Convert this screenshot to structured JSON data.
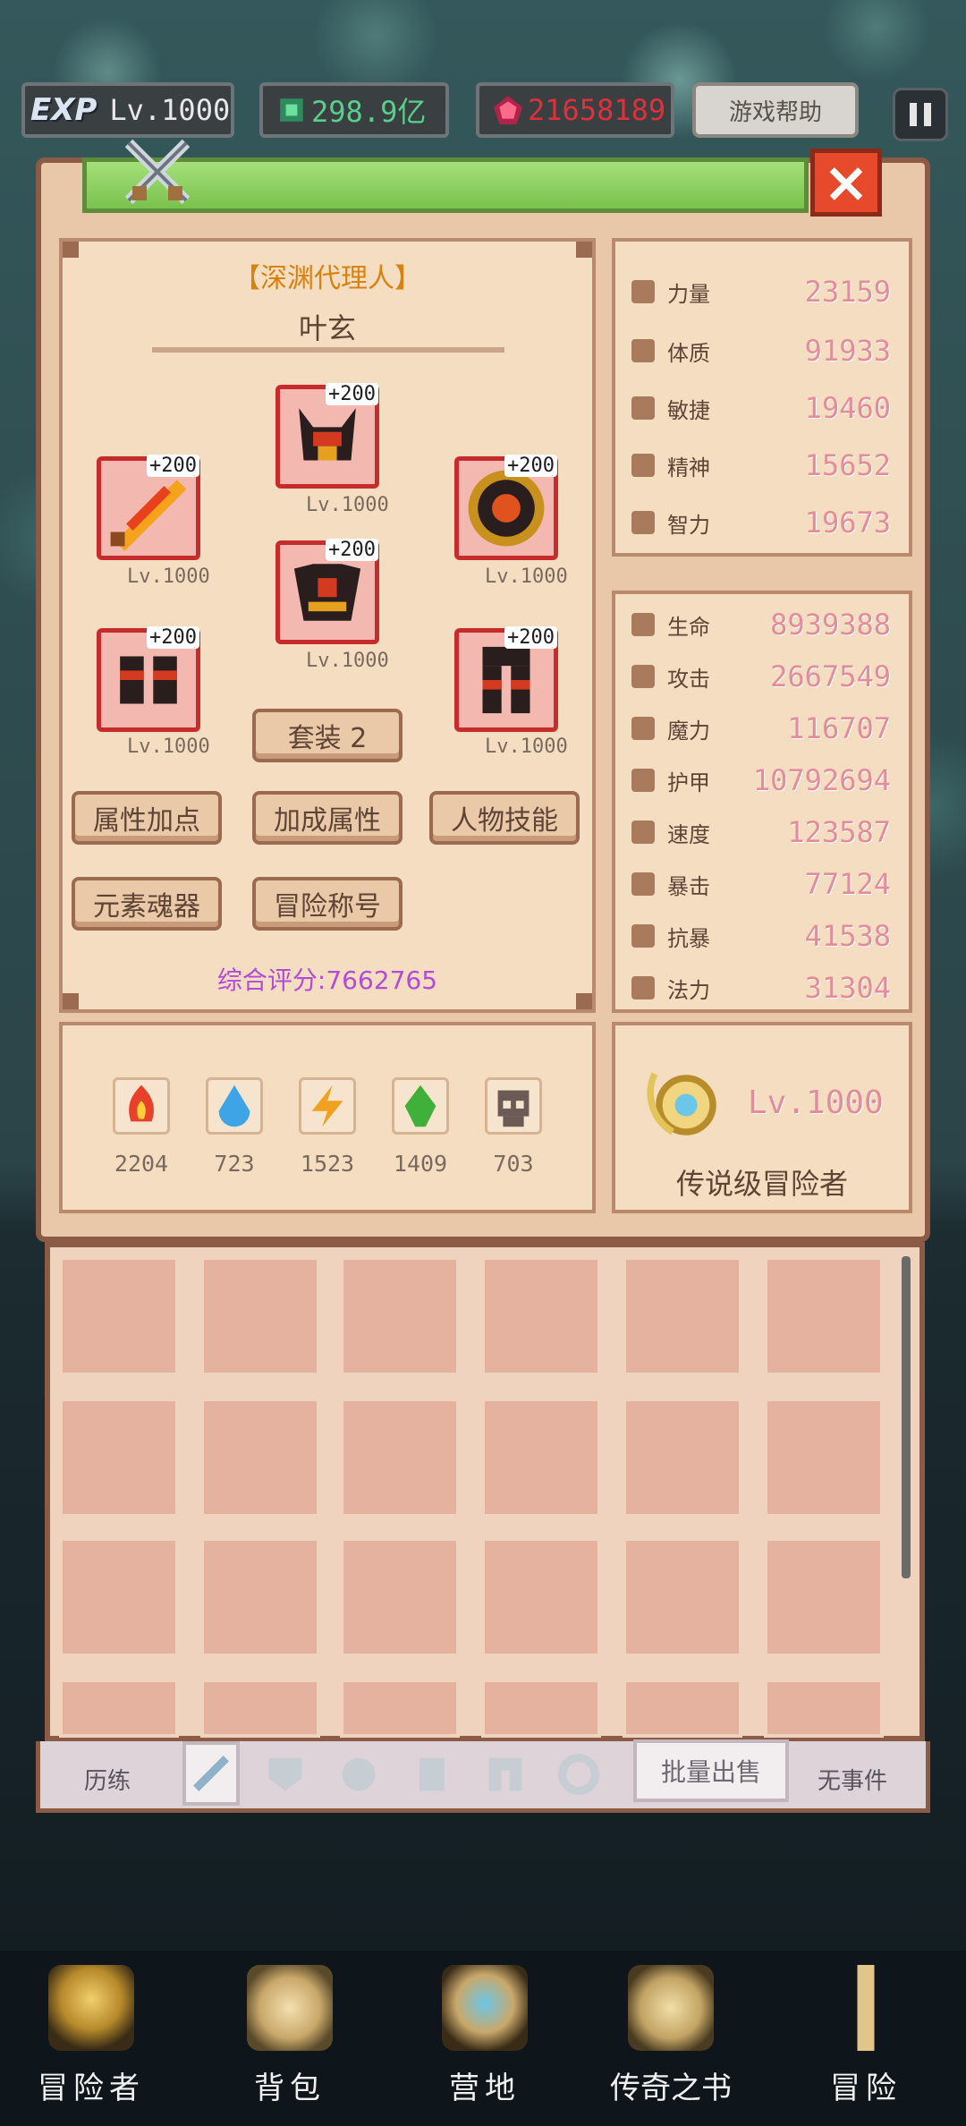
{
  "topbar": {
    "exp_label": "EXP",
    "level": "Lv.1000",
    "green_currency": "298.9亿",
    "red_currency": "21658189",
    "help_button": "游戏帮助"
  },
  "character": {
    "title": "【深渊代理人】",
    "name": "叶玄",
    "set_button": "套装 2",
    "score": "综合评分:7662765",
    "equipment": [
      {
        "slot": "helmet",
        "plus": "+200",
        "level": "Lv.1000",
        "icon": "horned-helmet-icon"
      },
      {
        "slot": "weapon",
        "plus": "+200",
        "level": "Lv.1000",
        "icon": "flame-sword-icon"
      },
      {
        "slot": "shield",
        "plus": "+200",
        "level": "Lv.1000",
        "icon": "round-shield-icon"
      },
      {
        "slot": "armor",
        "plus": "+200",
        "level": "Lv.1000",
        "icon": "chest-armor-icon"
      },
      {
        "slot": "gloves",
        "plus": "+200",
        "level": "Lv.1000",
        "icon": "gauntlets-icon"
      },
      {
        "slot": "legs",
        "plus": "+200",
        "level": "Lv.1000",
        "icon": "leg-armor-icon"
      }
    ]
  },
  "buttons": {
    "attr_points": "属性加点",
    "bonus_attr": "加成属性",
    "skills": "人物技能",
    "element_soul": "元素魂器",
    "adventure_title": "冒险称号"
  },
  "base_stats": [
    {
      "label": "力量",
      "value": "23159",
      "icon": "strength-icon"
    },
    {
      "label": "体质",
      "value": "91933",
      "icon": "heart-icon"
    },
    {
      "label": "敏捷",
      "value": "19460",
      "icon": "boot-icon"
    },
    {
      "label": "精神",
      "value": "15652",
      "icon": "spirit-icon"
    },
    {
      "label": "智力",
      "value": "19673",
      "icon": "brain-icon"
    }
  ],
  "combat_stats": [
    {
      "label": "生命",
      "value": "8939388",
      "icon": "heart-icon"
    },
    {
      "label": "攻击",
      "value": "2667549",
      "icon": "sword-icon"
    },
    {
      "label": "魔力",
      "value": "116707",
      "icon": "magic-icon"
    },
    {
      "label": "护甲",
      "value": "10792694",
      "icon": "shield-icon"
    },
    {
      "label": "速度",
      "value": "123587",
      "icon": "boot-icon"
    },
    {
      "label": "暴击",
      "value": "77124",
      "icon": "crit-icon"
    },
    {
      "label": "抗暴",
      "value": "41538",
      "icon": "anti-crit-icon"
    },
    {
      "label": "法力",
      "value": "31304",
      "icon": "mana-icon"
    }
  ],
  "elements": [
    {
      "value": "2204",
      "icon": "fire-element-icon",
      "color": "#e8412a"
    },
    {
      "value": "723",
      "icon": "water-element-icon",
      "color": "#3ea4e6"
    },
    {
      "value": "1523",
      "icon": "lightning-element-icon",
      "color": "#f0a21e"
    },
    {
      "value": "1409",
      "icon": "earth-element-icon",
      "color": "#3fb13a"
    },
    {
      "value": "703",
      "icon": "skull-element-icon",
      "color": "#6b5a55"
    }
  ],
  "rank": {
    "level": "Lv.1000",
    "title": "传说级冒险者"
  },
  "inventory_tabs": {
    "left": "历练",
    "batch_sell": "批量出售",
    "right": "无事件"
  },
  "nav": [
    {
      "label": "冒险者",
      "icon": "adventurer-icon"
    },
    {
      "label": "背包",
      "icon": "backpack-icon"
    },
    {
      "label": "营地",
      "icon": "camp-icon"
    },
    {
      "label": "传奇之书",
      "icon": "legend-book-icon"
    },
    {
      "label": "冒险",
      "icon": "adventure-sword-icon"
    }
  ],
  "colors": {
    "panel": "#e8c8a8",
    "stat_value": "#e38d9a",
    "score": "#b14bd8",
    "equip_border": "#c72c2c",
    "title_text": "#d9820f"
  }
}
